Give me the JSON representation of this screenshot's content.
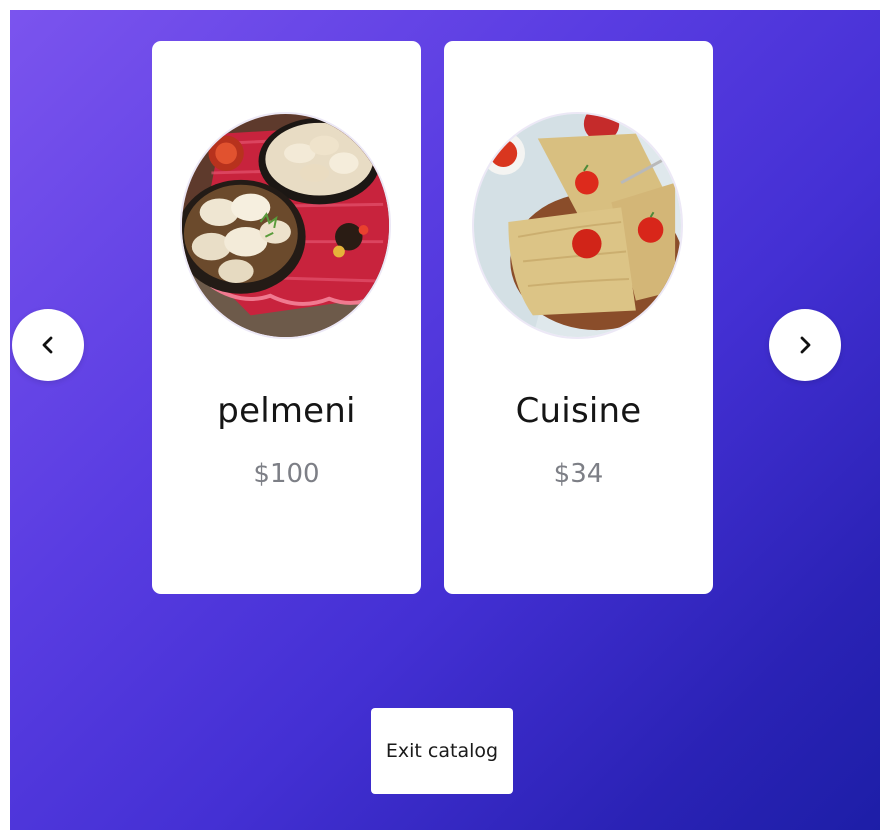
{
  "carousel": {
    "prev_icon": "chevron-left-icon",
    "next_icon": "chevron-right-icon",
    "items": [
      {
        "name": "pelmeni",
        "price": "$100",
        "image": "pelmeni-dumplings-photo"
      },
      {
        "name": "Cuisine",
        "price": "$34",
        "image": "blini-with-caviar-photo"
      }
    ]
  },
  "footer": {
    "exit_label": "Exit catalog"
  },
  "colors": {
    "gradient_start": "#7b54ee",
    "gradient_end": "#1d1ea7",
    "card_background": "#ffffff",
    "name_text": "#151515",
    "price_text": "#7d7f86"
  }
}
